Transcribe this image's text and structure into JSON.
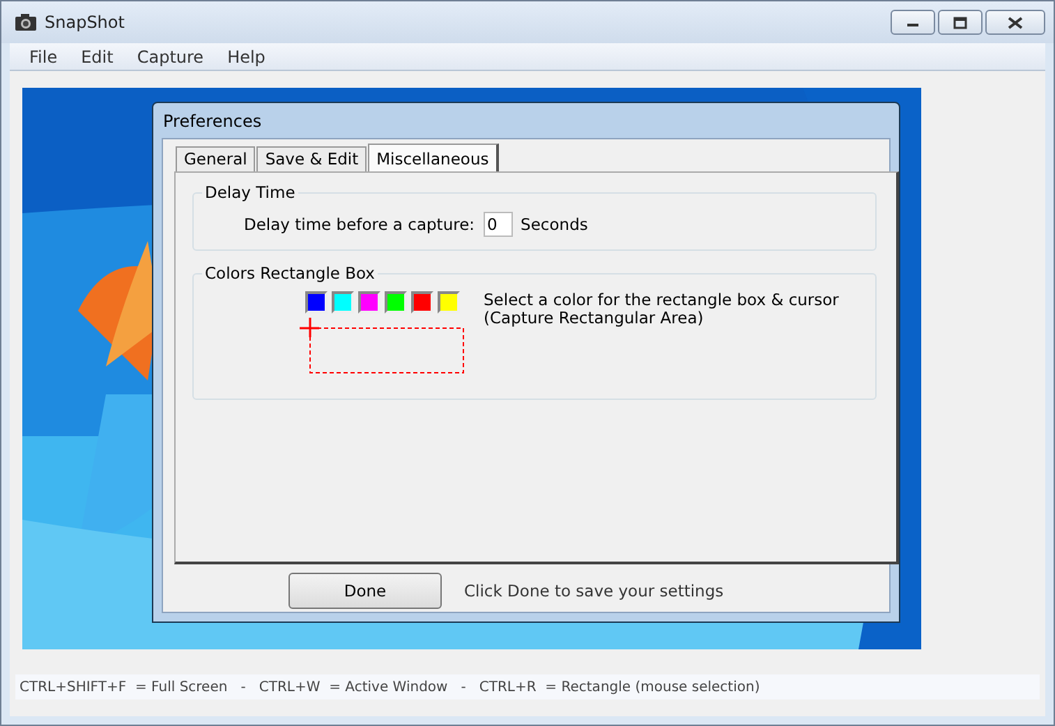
{
  "window": {
    "title": "SnapShot",
    "controls": [
      {
        "kind": "minimize"
      },
      {
        "kind": "maximize"
      },
      {
        "kind": "close"
      }
    ]
  },
  "menu": [
    "File",
    "Edit",
    "Capture",
    "Help"
  ],
  "dialog": {
    "title": "Preferences",
    "tabs": [
      {
        "label": "General",
        "selected": false
      },
      {
        "label": "Save & Edit",
        "selected": false
      },
      {
        "label": "Miscellaneous",
        "selected": true
      }
    ],
    "delay_group": {
      "title": "Delay Time",
      "label": "Delay time before a capture:",
      "value": "0",
      "unit": "Seconds"
    },
    "colors_group": {
      "title": "Colors Rectangle Box",
      "swatches": [
        {
          "color": "#0000ff"
        },
        {
          "color": "#00ffff"
        },
        {
          "color": "#ff00ff"
        },
        {
          "color": "#00ff00"
        },
        {
          "color": "#ff0000"
        },
        {
          "color": "#ffff00"
        }
      ],
      "rectangle": {
        "color": "#ff0000"
      },
      "hint": [
        "Select a color for the rectangle box & cursor",
        "(Capture Rectangular Area)"
      ]
    },
    "done_button": "Done",
    "done_hint": "Click Done to save your settings"
  },
  "status_bar": "CTRL+SHIFT+F  = Full Screen   -   CTRL+W  = Active Window   -   CTRL+R  = Rectangle (mouse selection)"
}
